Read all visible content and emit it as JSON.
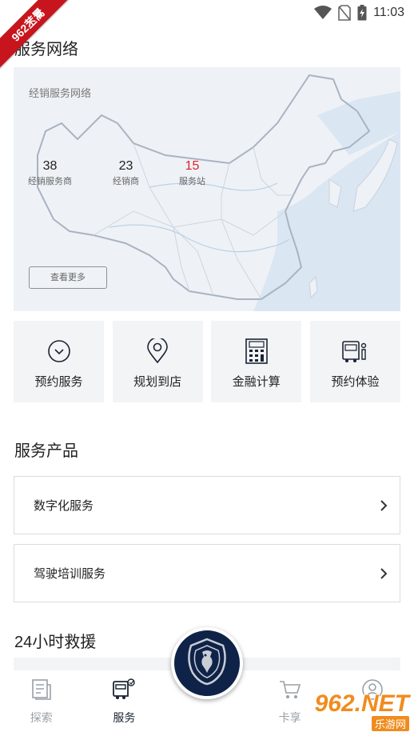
{
  "status": {
    "time": "11:03",
    "wifi_icon": "wifi-icon",
    "sim_icon": "no-sim-icon",
    "battery_icon": "battery-charging-icon"
  },
  "badge": {
    "text": "962苤暠"
  },
  "network": {
    "title": "服务网络",
    "map_label": "经销服务网络",
    "stats": [
      {
        "value": "38",
        "label": "经销服务商",
        "highlight": false
      },
      {
        "value": "23",
        "label": "经销商",
        "highlight": false
      },
      {
        "value": "15",
        "label": "服务站",
        "highlight": true
      }
    ],
    "more_label": "查看更多"
  },
  "quick": [
    {
      "label": "预约服务",
      "icon": "clock-icon"
    },
    {
      "label": "规划到店",
      "icon": "location-pin-icon"
    },
    {
      "label": "金融计算",
      "icon": "calculator-icon"
    },
    {
      "label": "预约体验",
      "icon": "truck-driver-icon"
    }
  ],
  "products": {
    "title": "服务产品",
    "items": [
      {
        "label": "数字化服务"
      },
      {
        "label": "驾驶培训服务"
      }
    ]
  },
  "rescue": {
    "title": "24小时救援"
  },
  "tabs": [
    {
      "label": "探索",
      "icon": "document-icon",
      "active": false
    },
    {
      "label": "服务",
      "icon": "truck-service-icon",
      "active": true
    },
    {
      "label": "",
      "icon": "scania-griffin-icon",
      "active": false
    },
    {
      "label": "卡享",
      "icon": "cart-icon",
      "active": false
    },
    {
      "label": "",
      "icon": "profile-icon",
      "active": false
    }
  ],
  "watermark": {
    "main": "962.NET",
    "sub": "乐游网"
  },
  "colors": {
    "accent_red": "#e0202a",
    "navy": "#0f2247",
    "badge_red": "#c8141c",
    "watermark_orange": "#f08c1e"
  }
}
